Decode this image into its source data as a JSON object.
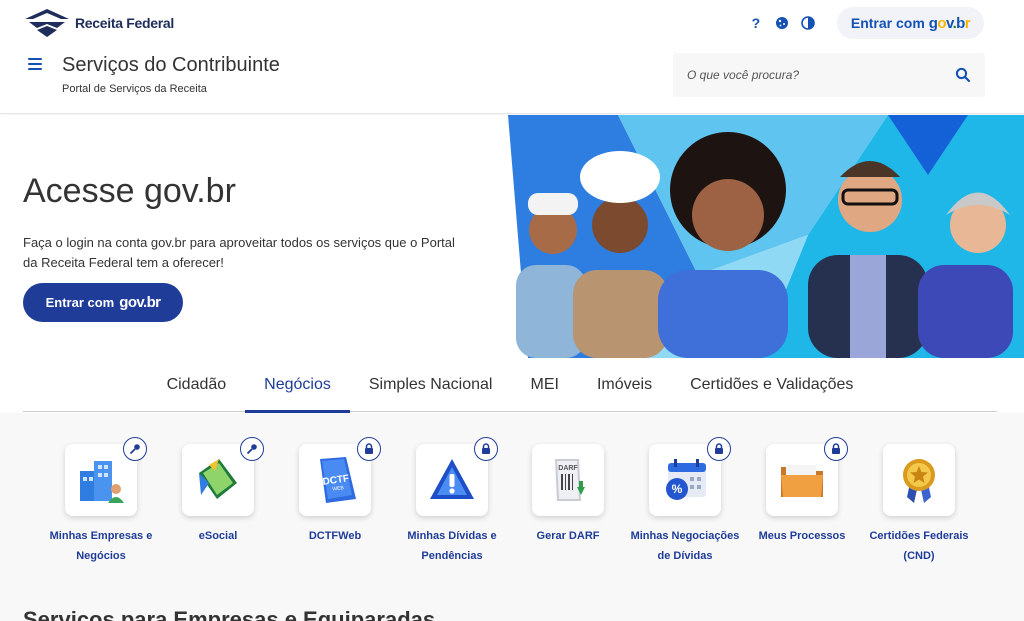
{
  "header": {
    "logo_text": "Receita Federal",
    "site_title": "Serviços do Contribuinte",
    "site_subtitle": "Portal de Serviços da Receita",
    "help_icon_glyph": "?",
    "tools_icons": [
      "help-icon",
      "cookie-icon",
      "contrast-icon"
    ],
    "login_label": "Entrar com",
    "search_placeholder": "O que você procura?"
  },
  "govbr": {
    "g": "g",
    "o": "o",
    "v": "v",
    "dot": ".",
    "b": "b",
    "r": "r"
  },
  "hero": {
    "title": "Acesse gov.br",
    "text": "Faça o login na conta gov.br para aproveitar todos os serviços que o Portal da Receita Federal tem a oferecer!",
    "button_label": "Entrar com",
    "button_brand": "gov.br"
  },
  "tabs": [
    {
      "label": "Cidadão",
      "active": false
    },
    {
      "label": "Negócios",
      "active": true
    },
    {
      "label": "Simples Nacional",
      "active": false
    },
    {
      "label": "MEI",
      "active": false
    },
    {
      "label": "Imóveis",
      "active": false
    },
    {
      "label": "Certidões e Validações",
      "active": false
    }
  ],
  "services": [
    {
      "label": "Minhas Empresas e Negócios",
      "badge": "key-icon",
      "icon": "buildings-icon"
    },
    {
      "label": "eSocial",
      "badge": "key-icon",
      "icon": "esocial-icon"
    },
    {
      "label": "DCTFWeb",
      "badge": "lock-icon",
      "icon": "dctfweb-icon",
      "icon_text": "DCTF",
      "icon_subtext": "WEB"
    },
    {
      "label": "Minhas Dívidas e Pendências",
      "badge": "lock-icon",
      "icon": "warning-icon"
    },
    {
      "label": "Gerar DARF",
      "badge": "",
      "icon": "darf-icon",
      "icon_text": "DARF"
    },
    {
      "label": "Minhas Negociações de Dívidas",
      "badge": "lock-icon",
      "icon": "calendar-percent-icon"
    },
    {
      "label": "Meus Processos",
      "badge": "lock-icon",
      "icon": "folder-icon"
    },
    {
      "label": "Certidões Federais (CND)",
      "badge": "",
      "icon": "medal-icon"
    }
  ],
  "section_heading": "Serviços para Empresas e Equiparadas",
  "colors": {
    "brand_blue": "#1351b4",
    "dark_blue": "#1f3c98",
    "govbr_yellow": "#f7b500",
    "govbr_green": "#168821"
  }
}
